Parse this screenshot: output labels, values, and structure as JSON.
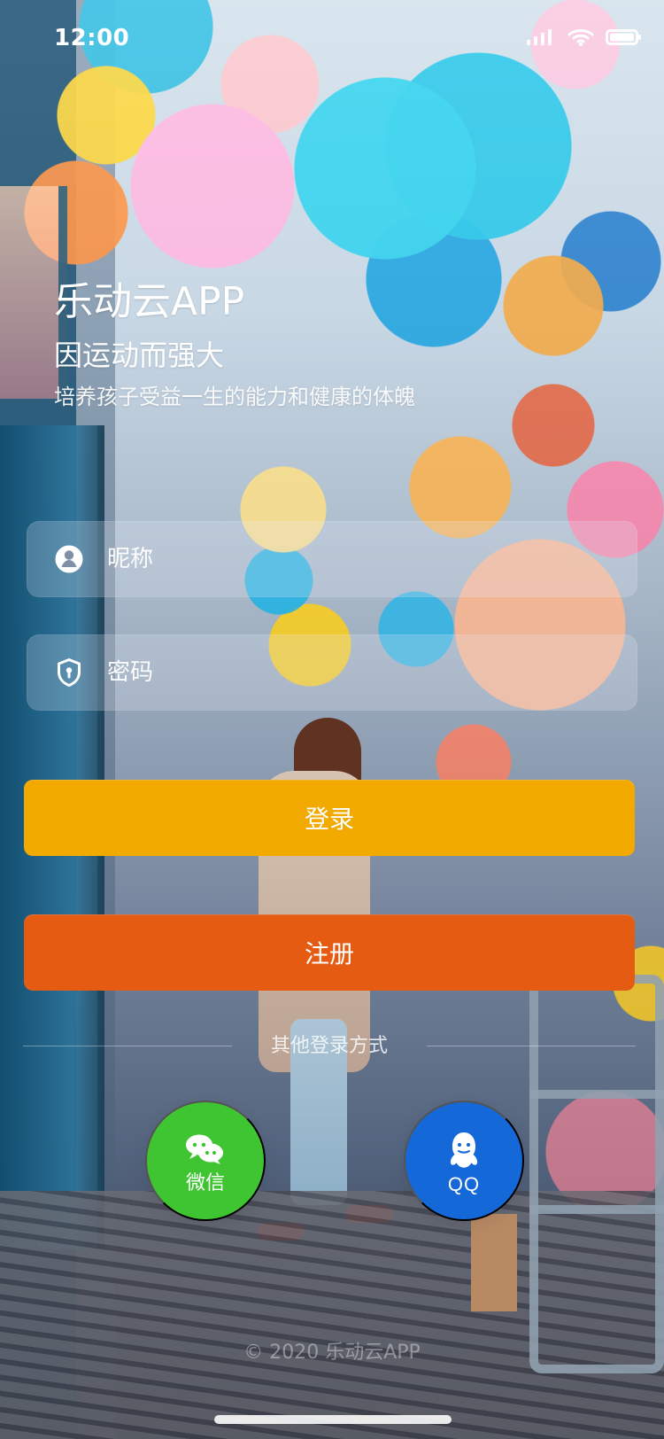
{
  "status_bar": {
    "time": "12:00",
    "icons": [
      "signal-icon",
      "wifi-icon",
      "battery-icon"
    ]
  },
  "hero": {
    "title": "乐动云APP",
    "slogan": "因运动而强大",
    "description": "培养孩子受益一生的能力和健康的体魄"
  },
  "form": {
    "nickname_placeholder": "昵称",
    "password_placeholder": "密码",
    "nickname_icon": "user-icon",
    "password_icon": "shield-keyhole-icon"
  },
  "actions": {
    "login_label": "登录",
    "register_label": "注册"
  },
  "social": {
    "divider_text": "其他登录方式",
    "wechat_label": "微信",
    "qq_label": "QQ",
    "wechat_icon": "wechat-icon",
    "qq_icon": "qq-icon"
  },
  "footer": {
    "copyright": "© 2020 乐动云APP"
  },
  "colors": {
    "login_button": "#F2A900",
    "register_button": "#E55B12",
    "wechat_button": "#40C532",
    "qq_button": "#1468D8",
    "text_primary": "#FFFFFF"
  }
}
